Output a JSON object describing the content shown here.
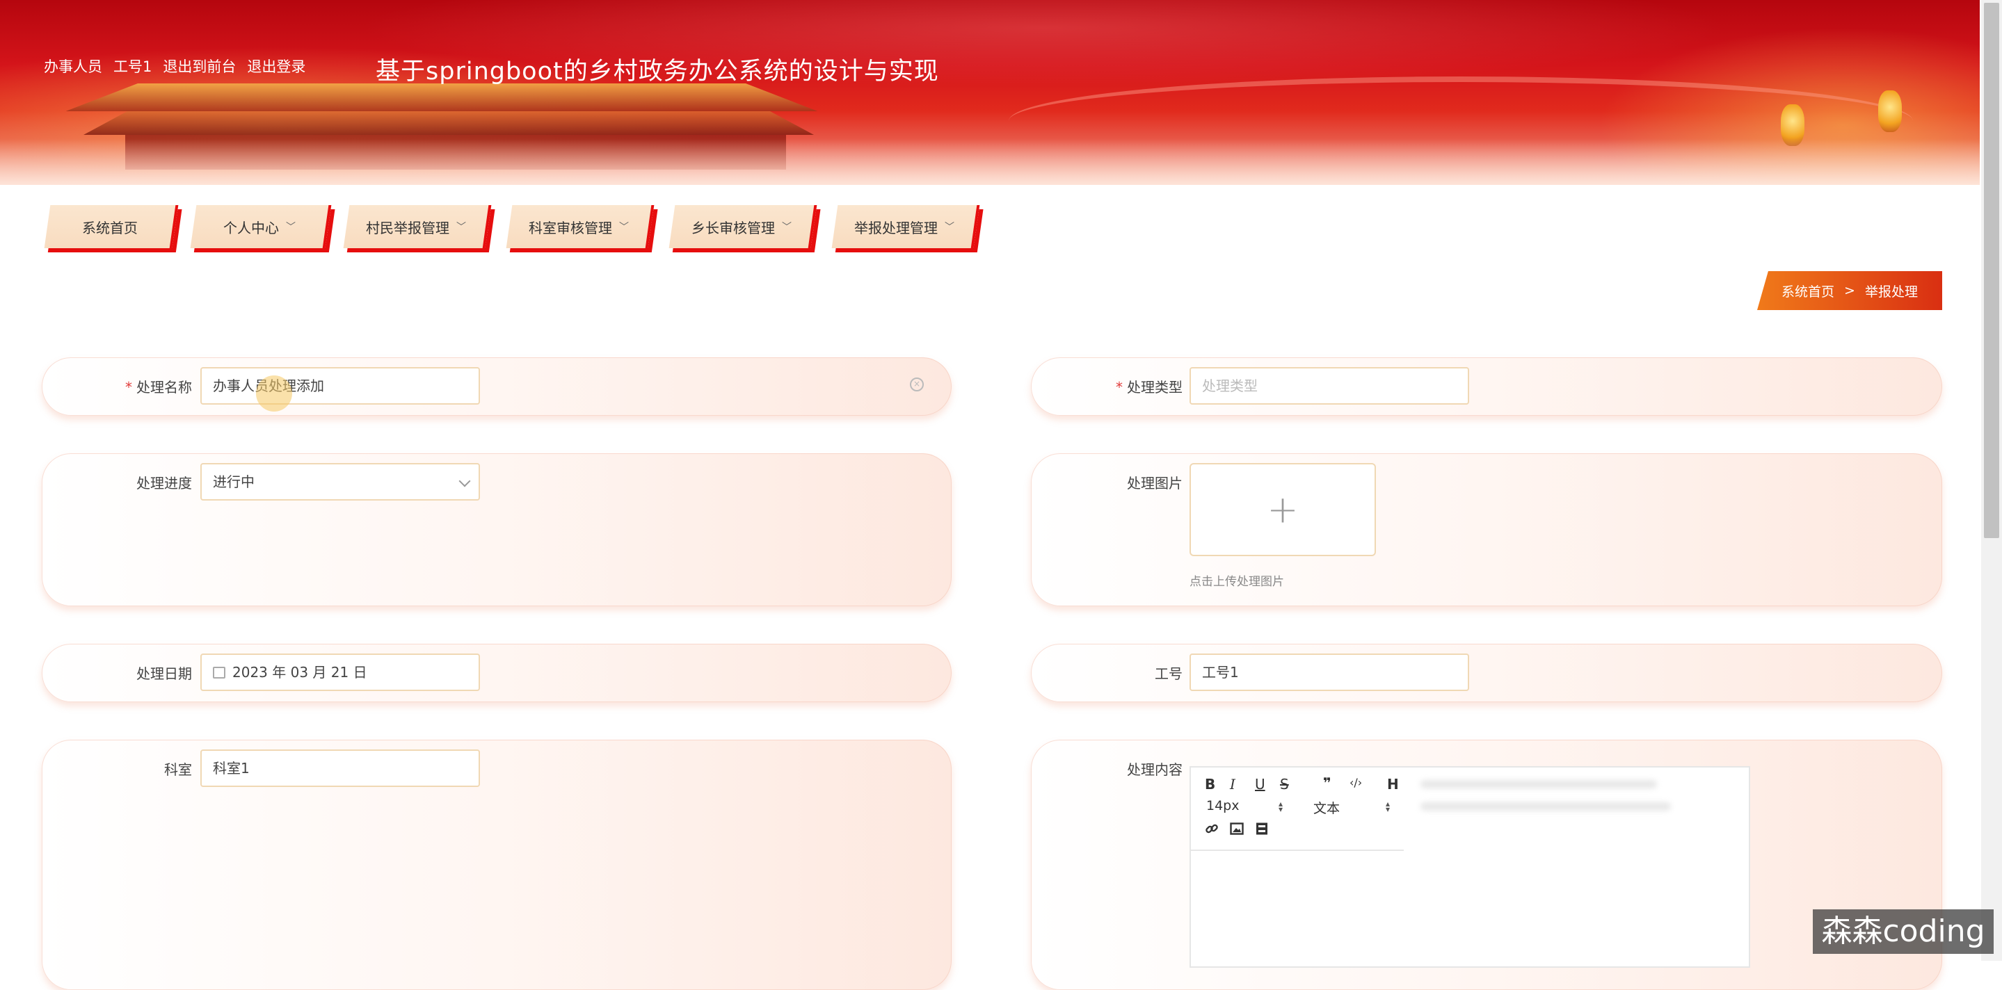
{
  "header": {
    "user_role": "办事人员",
    "user_name": "工号1",
    "back_to_front": "退出到前台",
    "logout": "退出登录",
    "site_title": "基于springboot的乡村政务办公系统的设计与实现"
  },
  "nav": {
    "items": [
      {
        "label": "系统首页",
        "has_dropdown": false
      },
      {
        "label": "个人中心",
        "has_dropdown": true
      },
      {
        "label": "村民举报管理",
        "has_dropdown": true
      },
      {
        "label": "科室审核管理",
        "has_dropdown": true
      },
      {
        "label": "乡长审核管理",
        "has_dropdown": true
      },
      {
        "label": "举报处理管理",
        "has_dropdown": true
      }
    ]
  },
  "breadcrumb": {
    "home": "系统首页",
    "separator": ">",
    "current": "举报处理"
  },
  "form": {
    "name": {
      "label": "处理名称",
      "required": true,
      "value": "办事人员处理添加"
    },
    "type": {
      "label": "处理类型",
      "required": true,
      "placeholder": "处理类型"
    },
    "progress": {
      "label": "处理进度",
      "value": "进行中"
    },
    "image": {
      "label": "处理图片",
      "hint": "点击上传处理图片"
    },
    "date": {
      "label": "处理日期",
      "value": "2023 年 03 月 21 日"
    },
    "job_no": {
      "label": "工号",
      "value": "工号1"
    },
    "department": {
      "label": "科室",
      "value": "科室1"
    },
    "content": {
      "label": "处理内容",
      "toolbar": {
        "bold": "B",
        "italic": "I",
        "underline": "U",
        "strike": "S",
        "quote": "❞",
        "code": "‹/›",
        "header": "H",
        "font_size": "14px",
        "text_style": "文本"
      }
    }
  },
  "icons": [
    "clear-icon",
    "chevron-down-icon",
    "calendar-icon",
    "plus-icon",
    "link-icon",
    "image-icon",
    "video-icon"
  ],
  "colors": {
    "accent_red": "#e60e0e",
    "breadcrumb_orange": "#f07a1a",
    "input_border": "#f0d8b4"
  },
  "watermark": "森森coding"
}
